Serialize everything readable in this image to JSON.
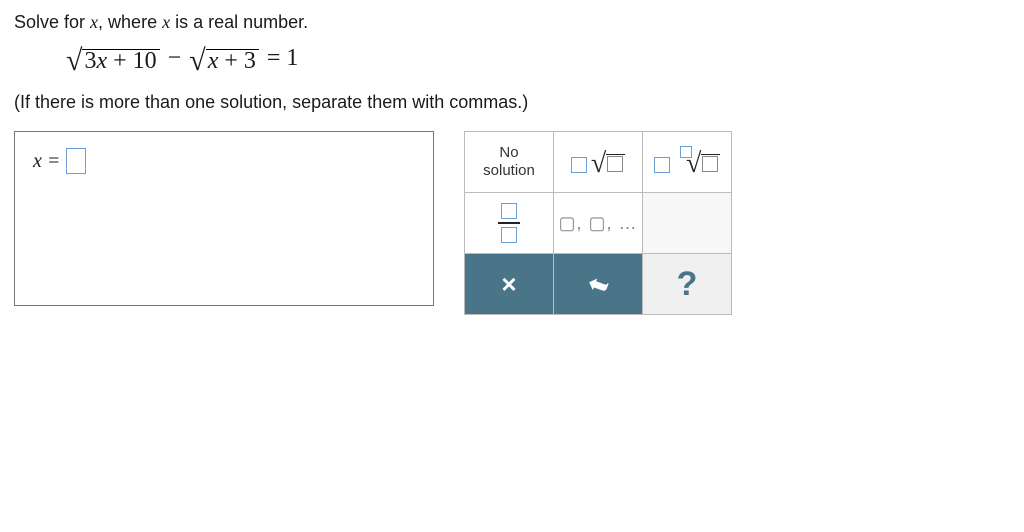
{
  "prompt": {
    "line1_pre": "Solve for ",
    "var": "x",
    "line1_mid": ", where ",
    "line1_post": " is a real number.",
    "line3": "(If there is more than one solution, separate them with commas.)"
  },
  "equation": {
    "rad1": "3x + 10",
    "minus": "−",
    "rad2": "x + 3",
    "rhs": "= 1"
  },
  "answer": {
    "lhs": "x ="
  },
  "palette": {
    "no_solution": "No\nsolution",
    "list_template": "▢ , ▢ , …",
    "clear": "×",
    "undo": "↶",
    "help": "?"
  }
}
